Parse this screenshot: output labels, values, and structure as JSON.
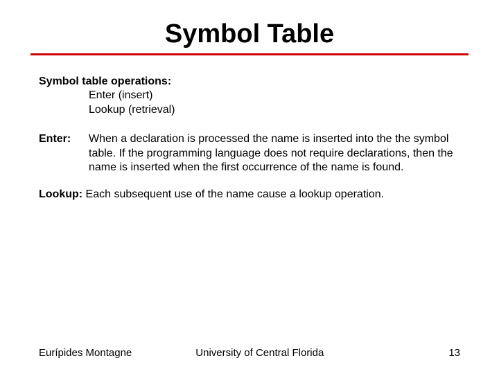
{
  "title": "Symbol Table",
  "ops": {
    "heading": "Symbol table operations:",
    "item1": "Enter (insert)",
    "item2": "Lookup (retrieval)"
  },
  "enter": {
    "term": "Enter:",
    "body": "When a declaration is processed the name is inserted into the the symbol table. If the programming language does not require declarations, then the name is inserted when the first occurrence of the name is found."
  },
  "lookup": {
    "term": "Lookup: ",
    "body": "Each subsequent  use of the name cause a lookup operation."
  },
  "footer": {
    "author": "Eurípides Montagne",
    "university": "University of Central Florida",
    "page": "13"
  }
}
